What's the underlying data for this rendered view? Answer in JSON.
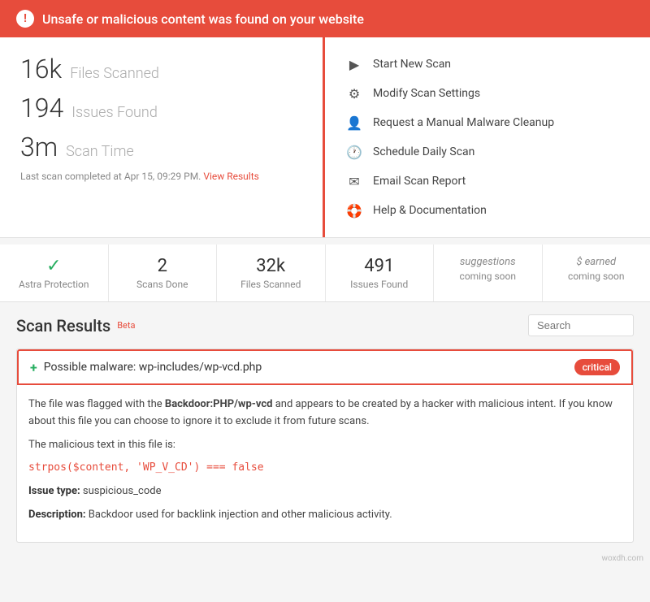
{
  "alert": {
    "message": "Unsafe or malicious content was found on your website"
  },
  "stats": {
    "files_scanned_value": "16k",
    "files_scanned_label": "Files Scanned",
    "issues_found_value": "194",
    "issues_found_label": "Issues Found",
    "scan_time_value": "3m",
    "scan_time_label": "Scan Time",
    "last_scan_text": "Last scan completed at Apr 15, 09:29 PM.",
    "view_results_label": "View Results"
  },
  "actions": [
    {
      "id": "start-scan",
      "label": "Start New Scan",
      "icon": "▶"
    },
    {
      "id": "modify-settings",
      "label": "Modify Scan Settings",
      "icon": "⚙"
    },
    {
      "id": "manual-cleanup",
      "label": "Request a Manual Malware Cleanup",
      "icon": "👤"
    },
    {
      "id": "schedule-scan",
      "label": "Schedule Daily Scan",
      "icon": "🕐"
    },
    {
      "id": "email-report",
      "label": "Email Scan Report",
      "icon": "✉"
    },
    {
      "id": "help-docs",
      "label": "Help & Documentation",
      "icon": "🛟"
    }
  ],
  "metrics": [
    {
      "id": "astra-protection",
      "value": "✓",
      "label": "Astra Protection",
      "type": "check"
    },
    {
      "id": "scans-done",
      "value": "2",
      "label": "Scans Done",
      "type": "number"
    },
    {
      "id": "files-scanned",
      "value": "32k",
      "label": "Files Scanned",
      "type": "number"
    },
    {
      "id": "issues-found",
      "value": "491",
      "label": "Issues Found",
      "type": "number"
    },
    {
      "id": "suggestions",
      "value": "suggestions",
      "label": "coming soon",
      "type": "coming-soon"
    },
    {
      "id": "earned",
      "value": "$ earned",
      "label": "coming soon",
      "type": "coming-soon"
    }
  ],
  "scan_results": {
    "title": "Scan Results",
    "beta_label": "Beta",
    "search_placeholder": "Search"
  },
  "issues": [
    {
      "id": "issue-1",
      "title": "Possible malware: wp-includes/wp-vcd.php",
      "severity": "critical",
      "description_html": "The file was flagged with the <strong>Backdoor:PHP/wp-vcd</strong> and appears to be created by a hacker with malicious intent. If you know about this file you can choose to ignore it to exclude it from future scans.",
      "malicious_text_label": "The malicious text in this file is:",
      "code_snippet": "strpos($content, 'WP_V_CD') === false",
      "issue_type_label": "Issue type:",
      "issue_type_value": "suspicious_code",
      "description_label": "Description:",
      "description_value": "Backdoor used for backlink injection and other malicious activity."
    }
  ],
  "watermark": "woxdh.com"
}
